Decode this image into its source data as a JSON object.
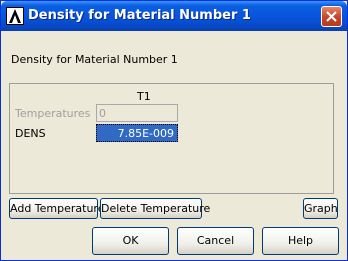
{
  "window": {
    "title": "Density for Material Number 1"
  },
  "dialog": {
    "prompt": "Density for Material Number 1",
    "column_header": "T1",
    "rows": [
      {
        "label": "Temperatures",
        "value": "0",
        "enabled": false
      },
      {
        "label": "DENS",
        "value": "7.85E-009",
        "enabled": true,
        "selected": true
      }
    ]
  },
  "buttons": {
    "add_temperature": "Add Temperature",
    "delete_temperature": "Delete Temperature",
    "graph": "Graph",
    "ok": "OK",
    "cancel": "Cancel",
    "help": "Help"
  },
  "colors": {
    "titlebar": "#0855dd",
    "selection": "#316ac5",
    "close_button": "#c8482c",
    "dialog_bg": "#ece9d8"
  },
  "icons": {
    "app": "ansys-logo-icon",
    "close": "close-icon"
  }
}
